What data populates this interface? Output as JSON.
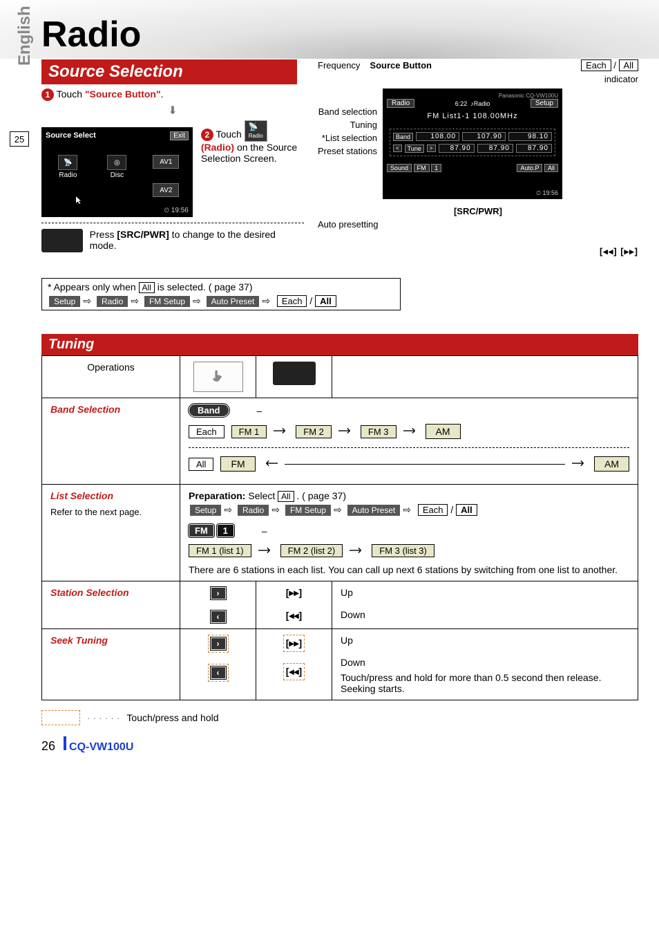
{
  "page": {
    "title": "Radio",
    "language_tab": "English",
    "side_page_number": "25",
    "footer_page_number": "26",
    "model": "CQ-VW100U"
  },
  "source_selection": {
    "header": "Source Selection",
    "step1_prefix": "Touch ",
    "step1_bold": "\"Source Button\"",
    "step1_suffix": ".",
    "screen": {
      "title": "Source Select",
      "exit": "Exit",
      "items": {
        "radio": "Radio",
        "disc": "Disc",
        "av1": "AV1",
        "av2": "AV2"
      },
      "clock": "19:56"
    },
    "step2_prefix": "Touch ",
    "step2_bold": "(Radio)",
    "step2_tail": " on the Source Selection Screen.",
    "antenna_icon_label": "Radio",
    "remote_note_prefix": "Press ",
    "remote_note_btn": "[SRC/PWR]",
    "remote_note_suffix": " to change to the desired mode."
  },
  "radio_overview": {
    "frequency_label": "Frequency",
    "source_button_label": "Source Button",
    "each": "Each",
    "all": "All",
    "indicator": "indicator",
    "side_labels": {
      "band": "Band selection",
      "tuning": "Tuning",
      "list": "*List selection",
      "presets": "Preset stations",
      "autopreset": "Auto presetting"
    },
    "screen": {
      "brand": "Panasonic",
      "model": "CQ-VW100U",
      "title": "Radio",
      "note_icon": "♪Radio",
      "time_hdr": "6:22",
      "setup": "Setup",
      "sub": "FM List1-1    108.00MHz",
      "band_btn": "Band",
      "tune_btn": "Tune",
      "freqs_row1": [
        "108.00",
        "107.90",
        "98.10"
      ],
      "freqs_row2": [
        "87.90",
        "87.90",
        "87.90"
      ],
      "sound": "Sound",
      "fm": "FM",
      "one": "1",
      "autop": "Auto.P",
      "all": "All",
      "clock": "19:56"
    },
    "srcpwr": "[SRC/PWR]",
    "navicons": "[◂◂] [▸▸]"
  },
  "footnote": {
    "line1_prefix": "* Appears only when ",
    "line1_all": "All",
    "line1_suffix": " is selected. (      page 37)",
    "chips": {
      "setup": "Setup",
      "radio": "Radio",
      "fmsetup": "FM Setup",
      "autopreset": "Auto Preset"
    },
    "each": "Each",
    "all": "All"
  },
  "tuning": {
    "header": "Tuning",
    "col_operations": "Operations",
    "rows": {
      "band": {
        "label": "Band Selection",
        "band_btn": "Band",
        "dash": "–",
        "each": "Each",
        "fm1": "FM 1",
        "fm2": "FM 2",
        "fm3": "FM 3",
        "am": "AM",
        "all": "All",
        "fm": "FM"
      },
      "list": {
        "label": "List Selection",
        "sub": "Refer to the next page.",
        "prep_bold": "Preparation:",
        "prep_tail": " Select ",
        "prep_all": "All",
        "prep_ref": ". (      page 37)",
        "chips": {
          "setup": "Setup",
          "radio": "Radio",
          "fmsetup": "FM Setup",
          "autopreset": "Auto Preset"
        },
        "each": "Each",
        "all": "All",
        "fm_chip": "FM",
        "one_chip": "1",
        "dash": "–",
        "l1": "FM 1 (list 1)",
        "l2": "FM 2 (list 2)",
        "l3": "FM 3 (list 3)",
        "note": "There are 6 stations in each list. You can call up next 6 stations by switching from one list to another."
      },
      "station": {
        "label": "Station Selection",
        "fwd": "[▸▸]",
        "rew": "[◂◂]",
        "up": "Up",
        "down": "Down"
      },
      "seek": {
        "label": "Seek Tuning",
        "fwd": "[▸▸]",
        "rew": "[◂◂]",
        "up": "Up",
        "down": "Down",
        "note": "Touch/press and hold for more than 0.5 second then release. Seeking starts."
      }
    },
    "legend": "Touch/press and hold"
  }
}
